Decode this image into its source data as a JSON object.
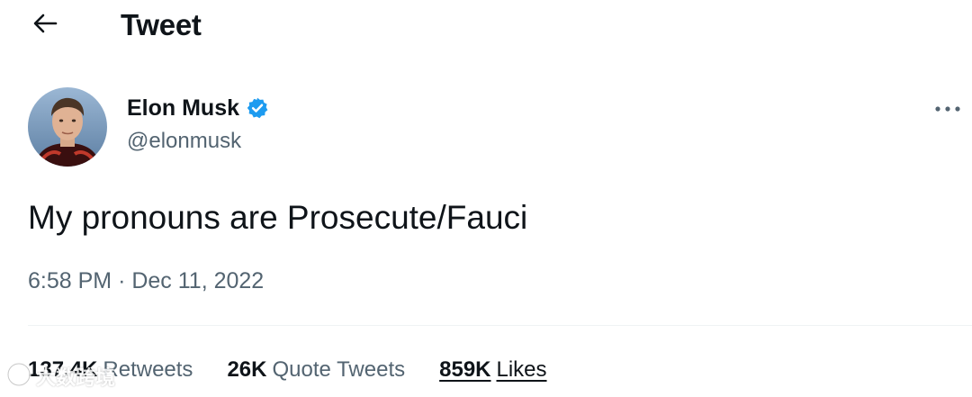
{
  "header": {
    "back_icon": "arrow-left-icon",
    "title": "Tweet"
  },
  "tweet": {
    "author": {
      "display_name": "Elon Musk",
      "handle": "@elonmusk",
      "verified_icon": "verified-badge-icon",
      "verified_color": "#1d9bf0"
    },
    "more_icon": "more-horizontal-icon",
    "text": "My pronouns are Prosecute/Fauci",
    "time": "6:58 PM",
    "separator": "·",
    "date": "Dec 11, 2022",
    "stats": [
      {
        "count": "137.4K",
        "label": "Retweets"
      },
      {
        "count": "26K",
        "label": "Quote Tweets"
      },
      {
        "count": "859K",
        "label": "Likes"
      }
    ]
  },
  "watermark": {
    "icon": "watermark-logo-icon",
    "text": "大数跨境"
  },
  "colors": {
    "text_primary": "#0f1419",
    "text_secondary": "#536471",
    "divider": "#eff3f4",
    "accent": "#1d9bf0"
  }
}
